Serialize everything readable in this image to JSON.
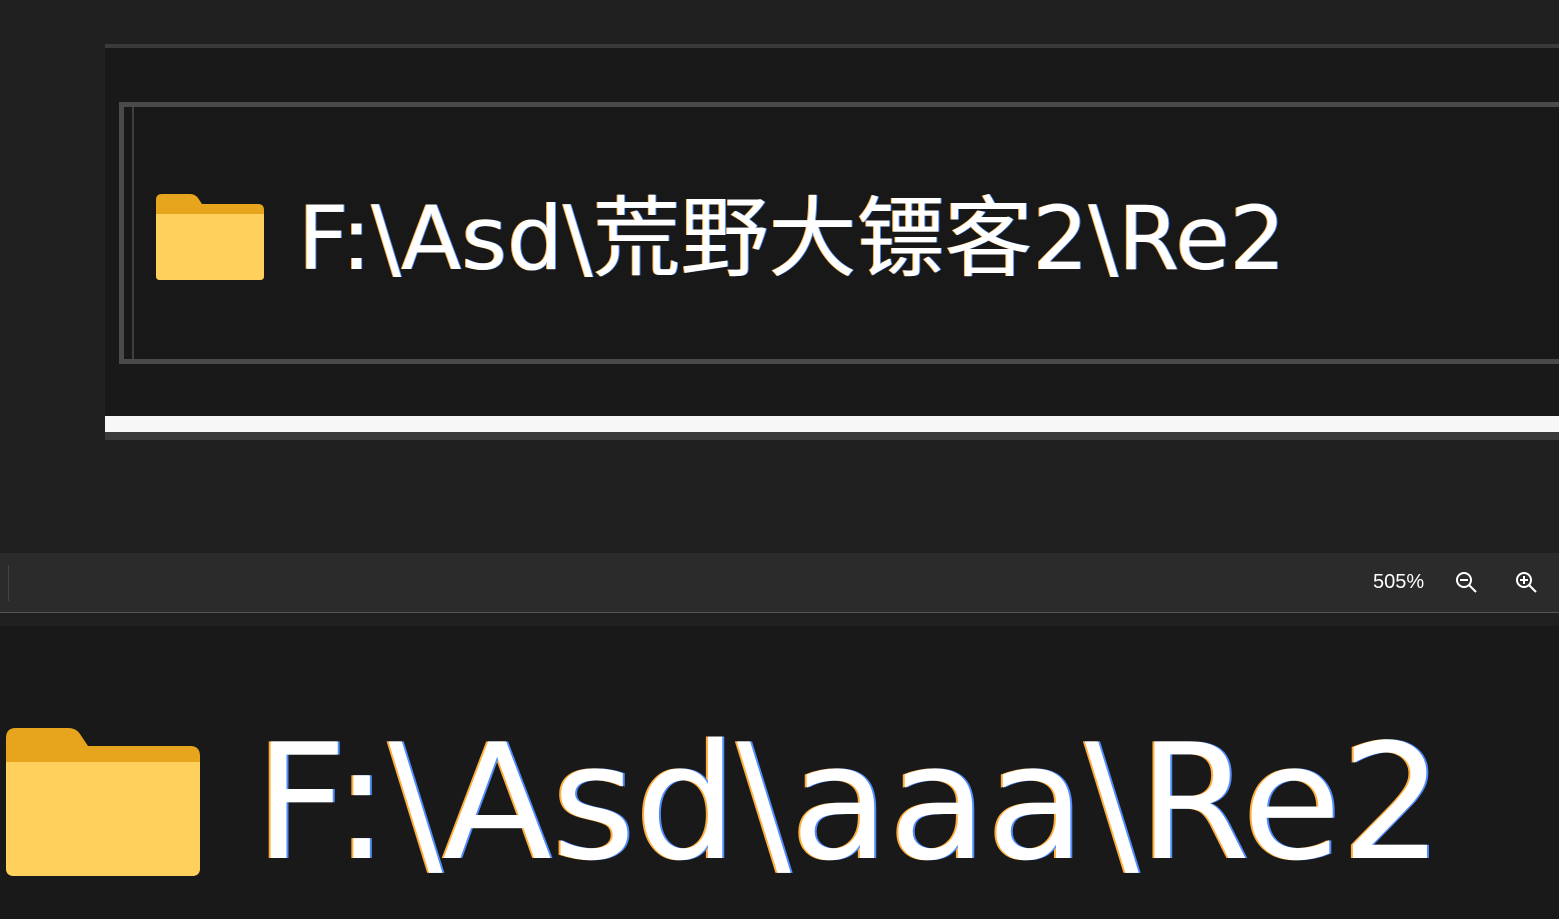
{
  "top_view": {
    "path_text": "F:\\Asd\\荒野大镖客2\\Re2"
  },
  "statusbar": {
    "zoom_level": "505%",
    "zoom_out_icon": "zoom-out-icon",
    "zoom_in_icon": "zoom-in-icon"
  },
  "bottom_view": {
    "path_text": "F:\\Asd\\aaa\\Re2"
  },
  "colors": {
    "background": "#202020",
    "panel": "#191919",
    "text": "#ffffff",
    "folder_yellow": "#ffd45c"
  }
}
